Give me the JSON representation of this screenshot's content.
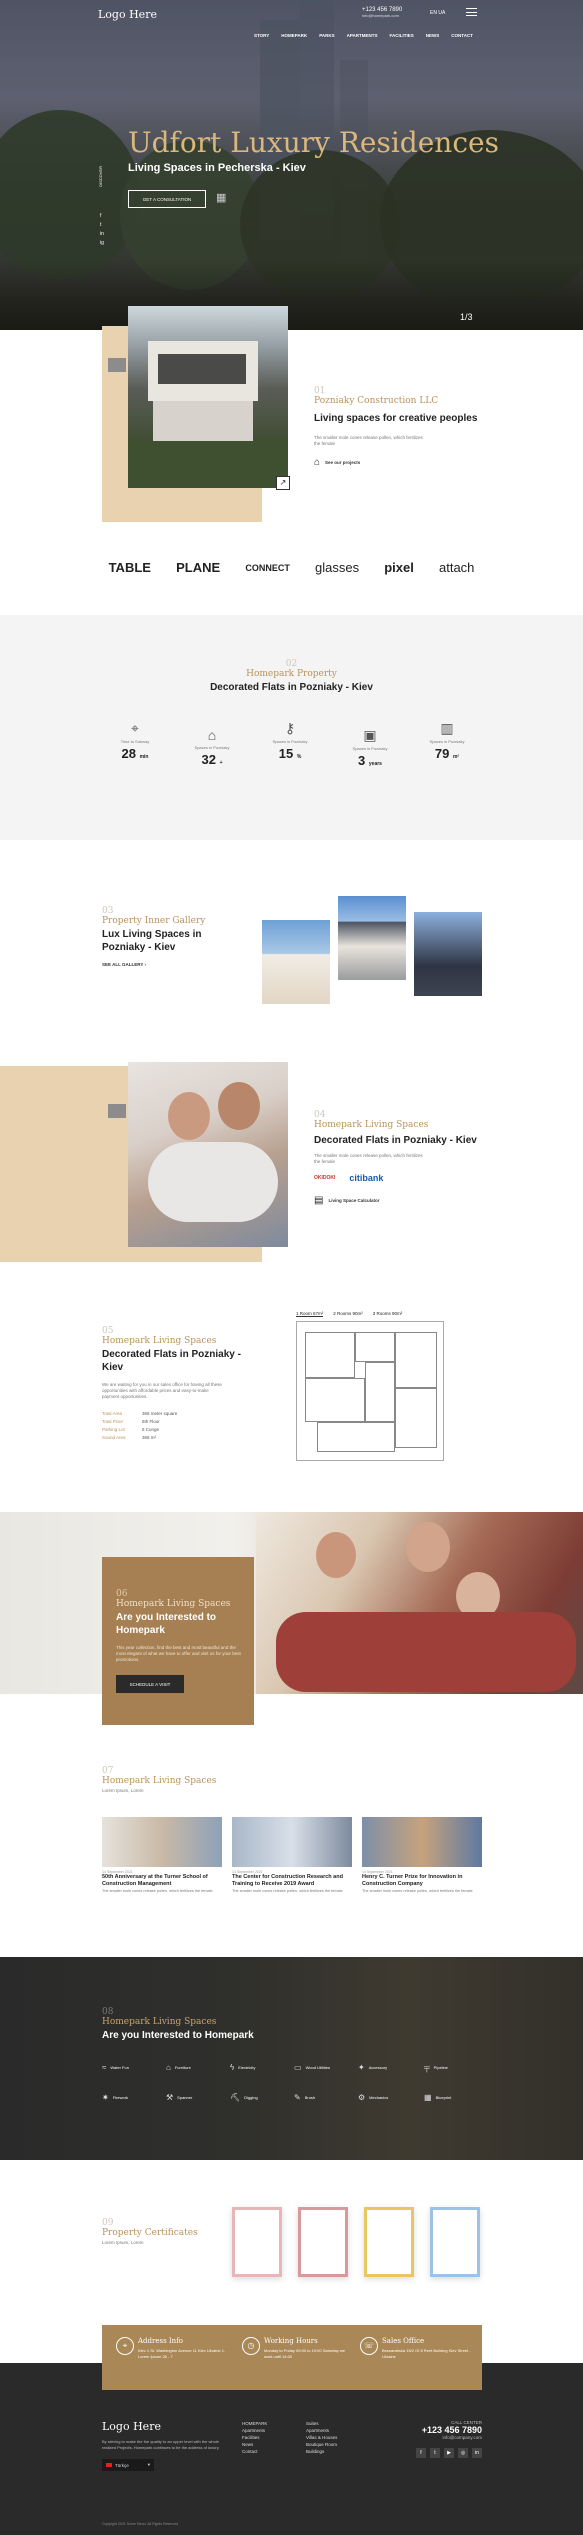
{
  "hero": {
    "logo": "Logo Here",
    "nav": [
      "STORY",
      "HOMEPARK",
      "PARKS",
      "APARTMENTS",
      "FACILITIES",
      "NEWS",
      "CONTACT"
    ],
    "phone": "+123 456 7890",
    "email": "info@homepark.com",
    "lang": "EN  UA",
    "title": "Udfort Luxury Residences",
    "subtitle": "Living Spaces in Pecherska - Kiev",
    "cta": "GET A CONSULTATION",
    "side_label": "DISCOVER",
    "social": [
      "f",
      "t",
      "in",
      "ig"
    ],
    "slides": "1/3"
  },
  "about": {
    "num": "01",
    "title": "Pozniaky Construction LLC",
    "heading": "Living spaces for creative peoples",
    "text": "The smaller mole cones release pollen, which fertilizes the female",
    "link": "See our projects"
  },
  "brands": [
    "TABLE",
    "PLANE",
    "CONNECT",
    "glasses",
    "pixel",
    "attach"
  ],
  "property": {
    "num": "02",
    "title": "Homepark Property",
    "heading": "Decorated Flats in Pozniaky - Kiev",
    "stats": [
      {
        "icon": "location-icon",
        "label": "Time to Subway",
        "value": "28",
        "unit": "min"
      },
      {
        "icon": "house-icon",
        "label": "Spaces in Pozniaky",
        "value": "32",
        "unit": "+"
      },
      {
        "icon": "key-icon",
        "label": "Spaces in Pozniaky",
        "value": "15",
        "unit": "%"
      },
      {
        "icon": "image-icon",
        "label": "Spaces in Pozniaky",
        "value": "3",
        "unit": "years"
      },
      {
        "icon": "chart-icon",
        "label": "Spaces in Pozniaky",
        "value": "79",
        "unit": "m²"
      }
    ]
  },
  "gallery": {
    "num": "03",
    "title": "Property Inner Gallery",
    "heading": "Lux Living Spaces in Pozniaky - Kiev",
    "link": "SEE ALL GALLERY"
  },
  "living": {
    "num": "04",
    "title": "Homepark Living Spaces",
    "heading": "Decorated Flats in Pozniaky - Kiev",
    "text": "The smaller mole cones release pollen, which fertilizes the female",
    "logos": [
      "OKIDOKI",
      "citibank"
    ],
    "link": "Living Space Calculator"
  },
  "plans": {
    "num": "05",
    "title": "Homepark Living Spaces",
    "heading": "Decorated Flats in Pozniaky - Kiev",
    "text": "We are waiting for you in our sales office for having all these opportunities with affordable prices and easy-to-make payment opportunities.",
    "tabs": [
      "1 Room 67m²",
      "2 Rooms 90m²",
      "3 Rooms 90m²"
    ],
    "specs": [
      {
        "k": "Total Area",
        "v": "365 meter square"
      },
      {
        "k": "Total Floor",
        "v": "5th Floor"
      },
      {
        "k": "Parking Lot",
        "v": "5 Cunge"
      },
      {
        "k": "Sound Area",
        "v": "365 m²"
      }
    ]
  },
  "interest": {
    "num": "06",
    "title": "Homepark Living Spaces",
    "heading": "Are you Interested to Homepark",
    "text": "This year collection, find the best and most beautiful and the most elegant of what we have to offer and visit us for your best promotions.",
    "button": "SCHEDULE A VISIT"
  },
  "news": {
    "num": "07",
    "title": "Homepark Living Spaces",
    "sub": "Lorem Ipsum, Lorem",
    "items": [
      {
        "date": "14 September 2021",
        "title": "50th Anniversary at the Turner School of Construction Management",
        "text": "The smaller mole cones release pollen, which fertilizes the female"
      },
      {
        "date": "14 September 2021",
        "title": "The Center for Construction Research and Training to Receive 2019 Award",
        "text": "The smaller mole cones release pollen, which fertilizes the female"
      },
      {
        "date": "14 September 2021",
        "title": "Henry C. Turner Prize for Innovation in Construction Company",
        "text": "The smaller mole cones release pollen, which fertilizes the female"
      }
    ]
  },
  "services": {
    "num": "08",
    "title": "Homepark Living Spaces",
    "heading": "Are you Interested to Homepark",
    "items": [
      "Water Fun",
      "Furniture",
      "Electricity",
      "Wood Utilities",
      "Accessory",
      "Pipeline",
      "Firework",
      "Spanner",
      "Digging",
      "Brush",
      "Mechanics",
      "Blueprint"
    ]
  },
  "certs": {
    "num": "09",
    "title": "Property Certificates",
    "sub": "Lorem Ipsum, Lorem"
  },
  "info": [
    {
      "icon": "pin-icon",
      "title": "Address Info",
      "text": "Kiev 1 St. Washington Avenue 11 Kiev Ukraine 1. Lorem Ipsum 26 - 7"
    },
    {
      "icon": "clock-icon",
      "title": "Working Hours",
      "text": "Monday to Friday 09:00 to 19:00 Saturday we work until 14:00"
    },
    {
      "icon": "phone-icon",
      "title": "Sales Office",
      "text": "Bessarabska 15/2 Of 8 Rent Building Kiev Street - Ukraine"
    }
  ],
  "footer": {
    "logo": "Logo Here",
    "about": "By striving to make the the quality to an upper level with the whole realized Projects, Homepark continues to be the address of luxury.",
    "lang_select": "Türkçe",
    "col1": [
      "HOMEPARK",
      "Apartments",
      "Facilities",
      "News",
      "Contact"
    ],
    "col2": [
      "Suites",
      "Apartments",
      "Villas & Houses",
      "Boutique Room",
      "Buildings"
    ],
    "call_label": "CALL CENTER",
    "phone": "+123 456 7890",
    "email": "info@company.com",
    "copyright": "Copyright 2021 Some Menu. All Rights Reserved"
  }
}
